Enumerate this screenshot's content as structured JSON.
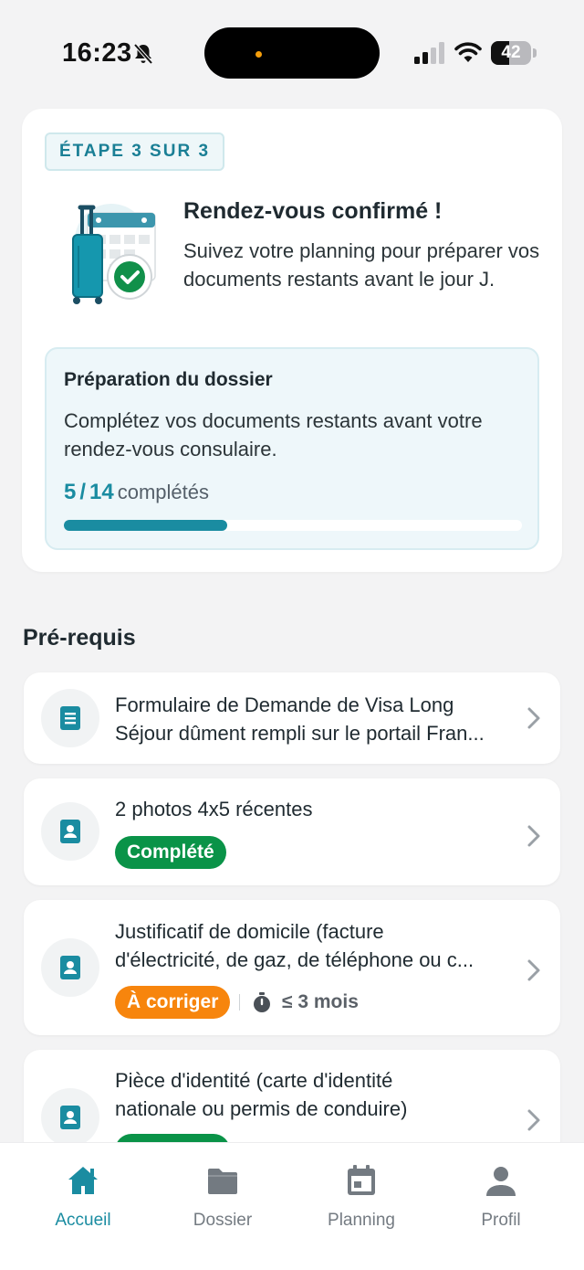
{
  "status_bar": {
    "time": "16:23",
    "battery": "42"
  },
  "step_card": {
    "badge": "ÉTAPE 3 SUR 3",
    "title": "Rendez-vous confirmé !",
    "text": "Suivez votre planning pour préparer vos documents restants avant le jour J.",
    "progress": {
      "title": "Préparation du dossier",
      "description": "Complétez vos documents restants avant votre rendez-vous consulaire.",
      "completed": "5",
      "separator": "/",
      "total": "14",
      "label": "complétés",
      "fraction": 0.357
    }
  },
  "prerequisites": {
    "title": "Pré-requis",
    "items": [
      {
        "line1": "Formulaire de Demande de Visa Long",
        "line2": "Séjour dûment rempli sur le portail Fran..."
      },
      {
        "line1": "2 photos 4x5 récentes",
        "status": "Complété"
      },
      {
        "line1": "Justificatif de domicile (facture",
        "line2": "d'électricité, de gaz, de téléphone ou c...",
        "status": "À corriger",
        "meta": "≤ 3 mois"
      },
      {
        "line1": "Pièce d'identité (carte d'identité",
        "line2": "nationale ou permis de conduire)"
      }
    ]
  },
  "nav": {
    "items": [
      {
        "label": "Accueil",
        "icon": "home-icon"
      },
      {
        "label": "Dossier",
        "icon": "folder-icon"
      },
      {
        "label": "Planning",
        "icon": "calendar-icon"
      },
      {
        "label": "Profil",
        "icon": "person-icon"
      }
    ],
    "active": "Accueil"
  },
  "colors": {
    "accent": "#1a8ca1",
    "success": "#0a9348",
    "warning": "#f7850d"
  }
}
